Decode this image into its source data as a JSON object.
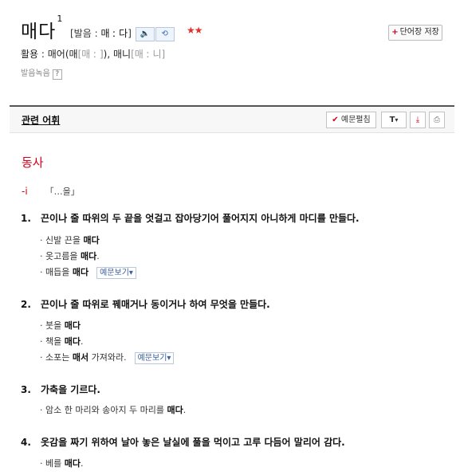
{
  "entry": {
    "headword": "매다",
    "superscript": "1",
    "pron_open": "[발음 : ",
    "pron_syllables": "매 ː 다",
    "pron_close": "]",
    "stars": "★★",
    "save_label": "단어장 저장",
    "conj_label": "활용 : ",
    "conj_form1": "매어(매",
    "conj_pron1": "[매 ː ]",
    "conj_mid": "), 매니",
    "conj_pron2": "[매 ː 니]",
    "rec_label": "발음녹음",
    "help_mark": "?"
  },
  "toolbar": {
    "related_label": "관련 어휘",
    "check_icon": "✔",
    "example_toggle_label": "예문펼침",
    "font_label": "T",
    "font_caret": "▾",
    "download_icon": "⤓",
    "print_icon": "⎙"
  },
  "colors": {
    "accent": "#d0021b",
    "link_blue": "#3a5f9f"
  },
  "definition": {
    "pos": "동사",
    "valency_mark": "-ⅰ",
    "valency_pattern": "「…을」",
    "senses": [
      {
        "num": "1.",
        "text": "끈이나 줄 따위의 두 끝을 엇걸고 잡아당기어 풀어지지 아니하게 마디를 만들다."
      },
      {
        "num": "2.",
        "text": "끈이나 줄 따위로 꿰매거나 동이거나 하여 무엇을 만들다."
      },
      {
        "num": "3.",
        "text": "가축을 기르다."
      },
      {
        "num": "4.",
        "text": "옷감을 짜기 위하여 날아 놓은 날실에 풀을 먹이고 고루 다듬어 말리어 감다."
      }
    ],
    "examples": {
      "s1e1": {
        "pre": "· 신발 끈을 ",
        "bold": "매다",
        "post": ""
      },
      "s1e2": {
        "pre": "· 옷고름을 ",
        "bold": "매다",
        "post": "."
      },
      "s1e3": {
        "pre": "· 매듭을 ",
        "bold": "매다",
        "post": ""
      },
      "s2e1": {
        "pre": "· 붓을 ",
        "bold": "매다",
        "post": ""
      },
      "s2e2": {
        "pre": "· 책을 ",
        "bold": "매다",
        "post": "."
      },
      "s2e3": {
        "pre": "· 소포는 ",
        "bold": "매서",
        "post": " 가져와라."
      },
      "s3e1": {
        "pre": "· 암소 한 마리와 송아지 두 마리를 ",
        "bold": "매다",
        "post": "."
      },
      "s4e1": {
        "pre": "· 베를 ",
        "bold": "매다",
        "post": "."
      }
    },
    "more_examples_label": "예문보기▾"
  }
}
